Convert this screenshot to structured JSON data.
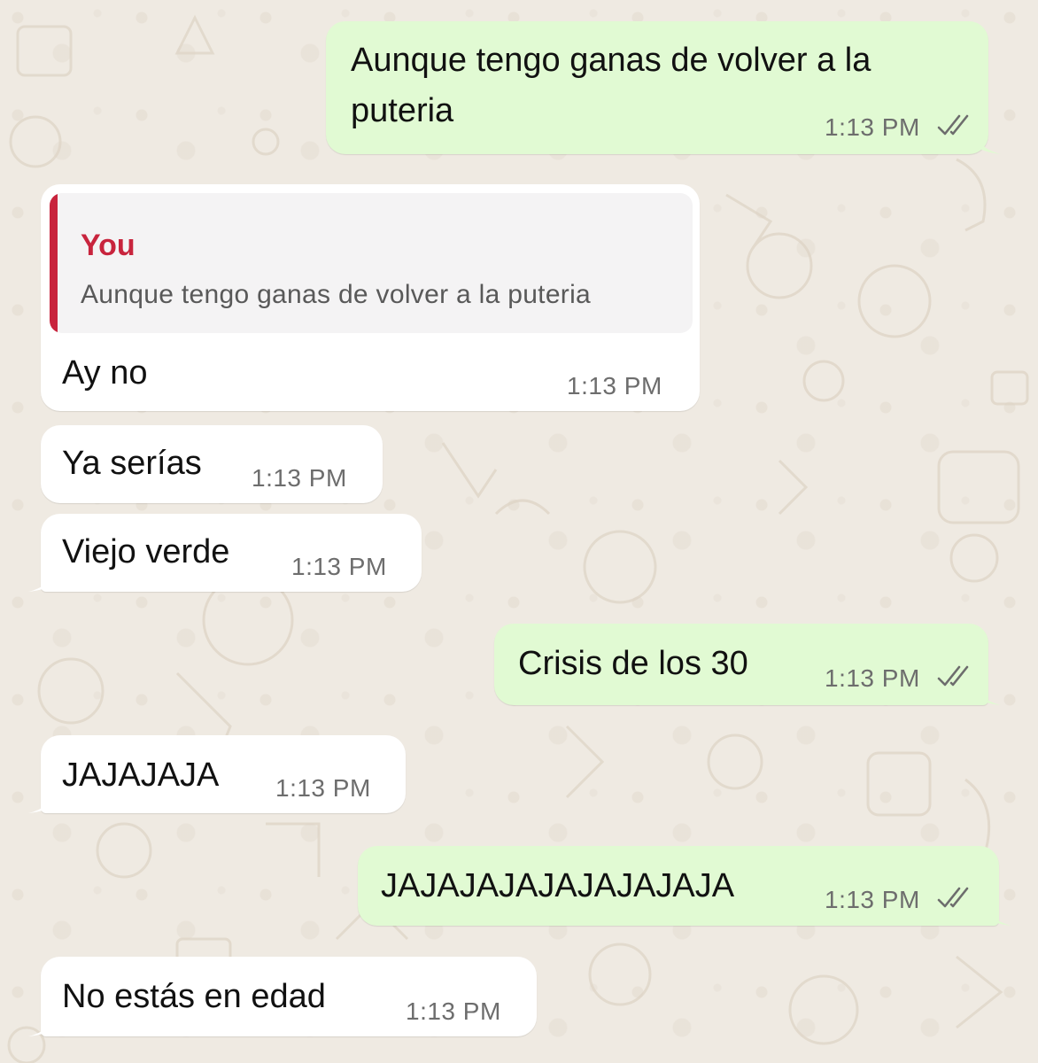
{
  "chat": {
    "messages": [
      {
        "direction": "outgoing",
        "text": "Aunque tengo ganas de volver a la puteria",
        "time": "1:13 PM",
        "status": "read"
      },
      {
        "direction": "incoming",
        "reply_to": {
          "author": "You",
          "text": "Aunque tengo ganas de volver a la puteria"
        },
        "text": "Ay no",
        "time": "1:13 PM"
      },
      {
        "direction": "incoming",
        "text": "Ya serías",
        "time": "1:13 PM"
      },
      {
        "direction": "incoming",
        "text": "Viejo verde",
        "time": "1:13 PM"
      },
      {
        "direction": "outgoing",
        "text": "Crisis de los 30",
        "time": "1:13 PM",
        "status": "read"
      },
      {
        "direction": "incoming",
        "text": "JAJAJAJA",
        "time": "1:13 PM"
      },
      {
        "direction": "outgoing",
        "text": "JAJAJAJAJAJAJAJAJA",
        "time": "1:13 PM",
        "status": "read"
      },
      {
        "direction": "incoming",
        "text": "No estás en edad",
        "time": "1:13 PM"
      }
    ]
  },
  "theme": {
    "wallpaper_color": "#efeae2",
    "incoming_bubble": "#ffffff",
    "outgoing_bubble": "#e1fad3",
    "quote_accent": "#c8243d",
    "timestamp_color": "#6d6d6d",
    "read_ticks_icon": "double-check-icon"
  }
}
